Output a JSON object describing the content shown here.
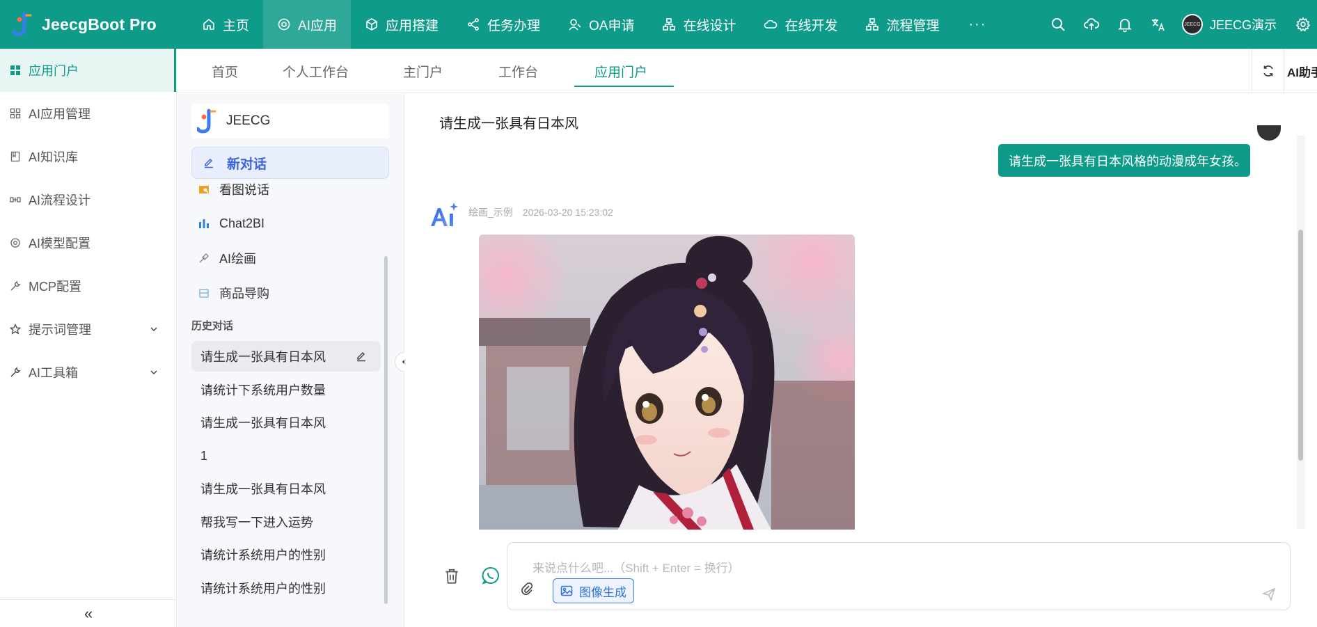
{
  "app": {
    "title": "JeecgBoot Pro"
  },
  "topnav": [
    {
      "label": "主页",
      "icon": "home-icon"
    },
    {
      "label": "AI应用",
      "icon": "ai-app-icon",
      "active": true
    },
    {
      "label": "应用搭建",
      "icon": "build-icon"
    },
    {
      "label": "任务办理",
      "icon": "task-icon"
    },
    {
      "label": "OA申请",
      "icon": "oa-icon"
    },
    {
      "label": "在线设计",
      "icon": "design-icon"
    },
    {
      "label": "在线开发",
      "icon": "cloud-icon"
    },
    {
      "label": "流程管理",
      "icon": "flow-icon"
    }
  ],
  "topnav_more": "···",
  "user": {
    "name": "JEECG演示"
  },
  "sidebar": {
    "items": [
      {
        "label": "应用门户",
        "icon": "grid-icon",
        "active": true
      },
      {
        "label": "AI应用管理",
        "icon": "apps-icon"
      },
      {
        "label": "AI知识库",
        "icon": "book-icon"
      },
      {
        "label": "AI流程设计",
        "icon": "flow-design-icon"
      },
      {
        "label": "AI模型配置",
        "icon": "gear-icon"
      },
      {
        "label": "MCP配置",
        "icon": "wrench-icon"
      },
      {
        "label": "提示词管理",
        "icon": "star-icon",
        "expandable": true
      },
      {
        "label": "AI工具箱",
        "icon": "tool-icon",
        "expandable": true
      }
    ],
    "collapse_label": "«"
  },
  "tabs": [
    {
      "label": "首页"
    },
    {
      "label": "个人工作台"
    },
    {
      "label": "主门户"
    },
    {
      "label": "工作台"
    },
    {
      "label": "应用门户",
      "active": true
    }
  ],
  "tab_ai_label": "AI助手",
  "chat_app": {
    "name": "JEECG",
    "new_chat_label": "新对话",
    "quick_items": [
      {
        "label": "看图说话",
        "icon": "image-chat-icon"
      },
      {
        "label": "Chat2BI",
        "icon": "bar-chart-icon"
      },
      {
        "label": "AI绘画",
        "icon": "paint-icon"
      },
      {
        "label": "商品导购",
        "icon": "shop-icon"
      }
    ],
    "history_title": "历史对话",
    "history": [
      {
        "label": "请生成一张具有日本风",
        "active": true
      },
      {
        "label": "请统计下系统用户数量"
      },
      {
        "label": "请生成一张具有日本风"
      },
      {
        "label": "1"
      },
      {
        "label": "请生成一张具有日本风"
      },
      {
        "label": "帮我写一下进入运势"
      },
      {
        "label": "请统计系统用户的性别"
      },
      {
        "label": "请统计系统用户的性别"
      }
    ]
  },
  "chat": {
    "title": "请生成一张具有日本风",
    "user_message": "请生成一张具有日本风格的动漫成年女孩。",
    "ai_name": "绘画_示例",
    "ai_time": "2026-03-20 15:23:02",
    "input_placeholder": "来说点什么吧...（Shift + Enter = 换行）",
    "image_gen_label": "图像生成"
  },
  "colors": {
    "primary": "#0f9b8a",
    "accent_blue": "#3d63dd"
  }
}
